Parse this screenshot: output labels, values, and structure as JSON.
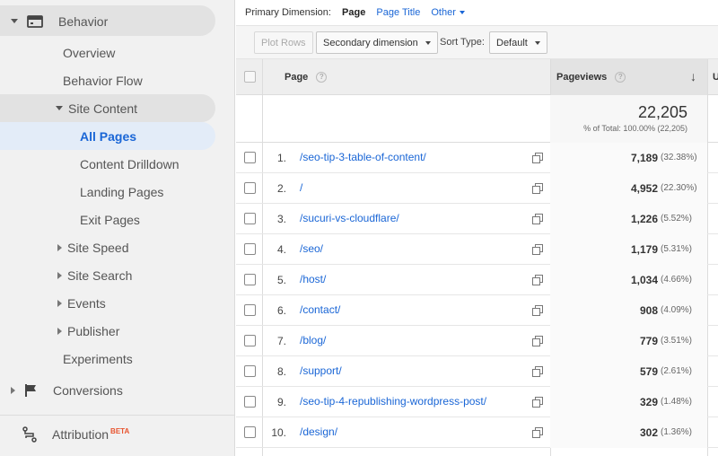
{
  "sidebar": {
    "section": "Behavior",
    "items": [
      {
        "label": "Overview"
      },
      {
        "label": "Behavior Flow"
      },
      {
        "label": "Site Content"
      },
      {
        "label": "All Pages"
      },
      {
        "label": "Content Drilldown"
      },
      {
        "label": "Landing Pages"
      },
      {
        "label": "Exit Pages"
      },
      {
        "label": "Site Speed"
      },
      {
        "label": "Site Search"
      },
      {
        "label": "Events"
      },
      {
        "label": "Publisher"
      },
      {
        "label": "Experiments"
      }
    ],
    "conversions": "Conversions",
    "attribution": "Attribution",
    "attribution_badge": "BETA"
  },
  "primary_dimension": {
    "label": "Primary Dimension:",
    "options": [
      "Page",
      "Page Title",
      "Other"
    ]
  },
  "toolbar": {
    "plot_rows": "Plot Rows",
    "secondary_dimension": "Secondary dimension",
    "sort_type_label": "Sort Type:",
    "sort_type_value": "Default"
  },
  "table": {
    "headers": {
      "page": "Page",
      "pageviews": "Pageviews",
      "help": "?",
      "next_col_initial": "U"
    },
    "totals": {
      "value": "22,205",
      "sub": "% of Total: 100.00% (22,205)"
    },
    "rows": [
      {
        "num": "1.",
        "page": "/seo-tip-3-table-of-content/",
        "pageviews": "7,189",
        "pct": "(32.38%)"
      },
      {
        "num": "2.",
        "page": "/",
        "pageviews": "4,952",
        "pct": "(22.30%)"
      },
      {
        "num": "3.",
        "page": "/sucuri-vs-cloudflare/",
        "pageviews": "1,226",
        "pct": "(5.52%)"
      },
      {
        "num": "4.",
        "page": "/seo/",
        "pageviews": "1,179",
        "pct": "(5.31%)"
      },
      {
        "num": "5.",
        "page": "/host/",
        "pageviews": "1,034",
        "pct": "(4.66%)"
      },
      {
        "num": "6.",
        "page": "/contact/",
        "pageviews": "908",
        "pct": "(4.09%)"
      },
      {
        "num": "7.",
        "page": "/blog/",
        "pageviews": "779",
        "pct": "(3.51%)"
      },
      {
        "num": "8.",
        "page": "/support/",
        "pageviews": "579",
        "pct": "(2.61%)"
      },
      {
        "num": "9.",
        "page": "/seo-tip-4-republishing-wordpress-post/",
        "pageviews": "329",
        "pct": "(1.48%)"
      },
      {
        "num": "10.",
        "page": "/design/",
        "pageviews": "302",
        "pct": "(1.36%)"
      }
    ]
  },
  "colors": {
    "link": "#1a66d6",
    "active_bg": "#e3ecf8",
    "beta": "#e8542f"
  }
}
